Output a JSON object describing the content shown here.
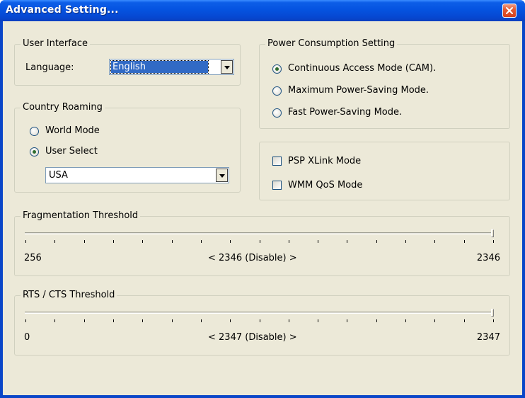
{
  "window": {
    "title": "Advanced Setting..."
  },
  "user_interface": {
    "legend": "User Interface",
    "language_label": "Language:",
    "language_value": "English"
  },
  "country_roaming": {
    "legend": "Country Roaming",
    "world_mode": "World Mode",
    "user_select": "User Select",
    "selected_option": "user_select",
    "country_value": "USA"
  },
  "power": {
    "legend": "Power Consumption Setting",
    "options": [
      {
        "label": "Continuous Access Mode (CAM).",
        "checked": true
      },
      {
        "label": "Maximum Power-Saving Mode.",
        "checked": false
      },
      {
        "label": "Fast Power-Saving Mode.",
        "checked": false
      }
    ]
  },
  "modes": {
    "psp_xlink": {
      "label": "PSP XLink Mode",
      "checked": false
    },
    "wmm_qos": {
      "label": "WMM QoS Mode",
      "checked": false
    }
  },
  "fragmentation": {
    "legend": "Fragmentation Threshold",
    "min_label": "256",
    "center_label": "< 2346 (Disable) >",
    "max_label": "2346",
    "min": 256,
    "max": 2346,
    "value": 2346
  },
  "rts_cts": {
    "legend": "RTS / CTS Threshold",
    "min_label": "0",
    "center_label": "< 2347 (Disable) >",
    "max_label": "2347",
    "min": 0,
    "max": 2347,
    "value": 2347
  }
}
